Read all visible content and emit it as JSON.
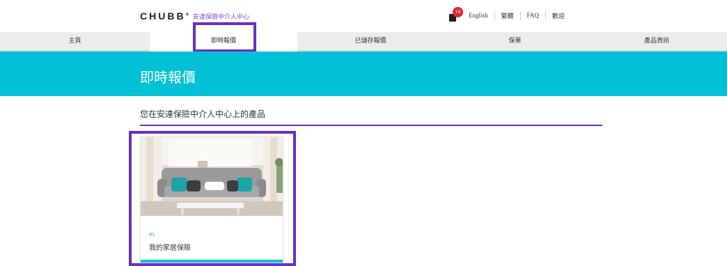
{
  "header": {
    "logo_text": "CHUBB",
    "logo_reg": "®",
    "portal_name": "安達保險中介人中心",
    "cart_count": "19",
    "links": [
      "English",
      "繁體",
      "FAQ",
      "歡迎"
    ]
  },
  "nav": {
    "items": [
      {
        "label": "主頁",
        "active": false
      },
      {
        "label": "即時報價",
        "active": true
      },
      {
        "label": "已儲存報價",
        "active": false
      },
      {
        "label": "保單",
        "active": false
      },
      {
        "label": "產品資訊",
        "active": false
      }
    ]
  },
  "banner": {
    "title": "即時報價"
  },
  "section": {
    "title": "您在安達保險中介人中心上的產品"
  },
  "product": {
    "tag": "IPL",
    "title": "我的家居保險",
    "image_icon": "living-room-sofa-photo"
  },
  "colors": {
    "accent_teal": "#00c1d5",
    "highlight_purple": "#6a2fc0",
    "badge_red": "#e0262d",
    "nav_bg": "#ececec"
  }
}
